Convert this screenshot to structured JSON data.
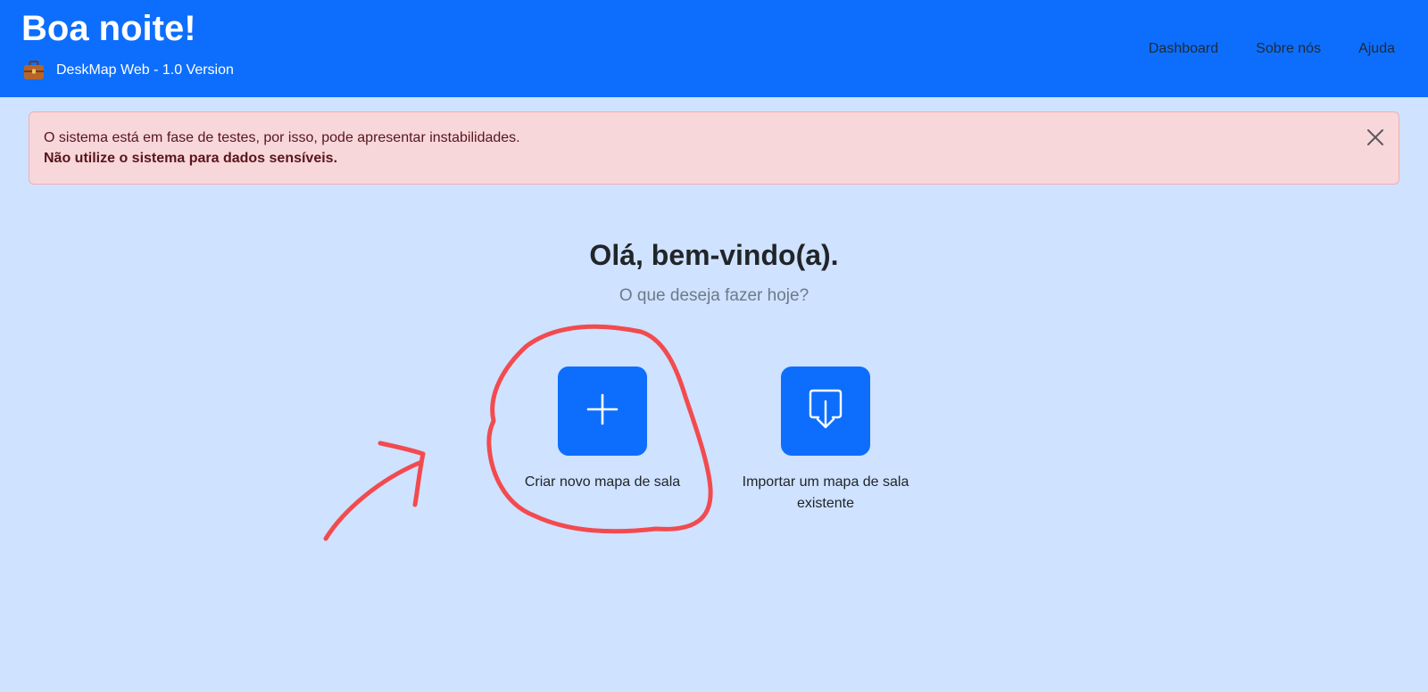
{
  "header": {
    "title": "Boa noite!",
    "subtitle": "DeskMap Web - 1.0 Version",
    "subtitle_icon": "briefcase-icon",
    "bg_color": "#0d6efd",
    "nav": [
      {
        "label": "Dashboard"
      },
      {
        "label": "Sobre nós"
      },
      {
        "label": "Ajuda"
      }
    ]
  },
  "alert": {
    "message": "O sistema está em fase de testes, por isso, pode apresentar instabilidades.",
    "warning": "Não utilize o sistema para dados sensíveis.",
    "close_icon": "close-icon",
    "bg_color": "#f8d7da"
  },
  "welcome": {
    "title": "Olá, bem-vindo(a).",
    "subtitle": "O que deseja fazer hoje?"
  },
  "actions": [
    {
      "label": "Criar novo mapa de sala",
      "icon": "plus-icon"
    },
    {
      "label": "Importar um mapa de sala existente",
      "icon": "import-icon"
    }
  ],
  "annotation": {
    "color": "#f24b4f",
    "shapes": [
      "circle-around-create",
      "arrow-pointing-to-create"
    ]
  }
}
